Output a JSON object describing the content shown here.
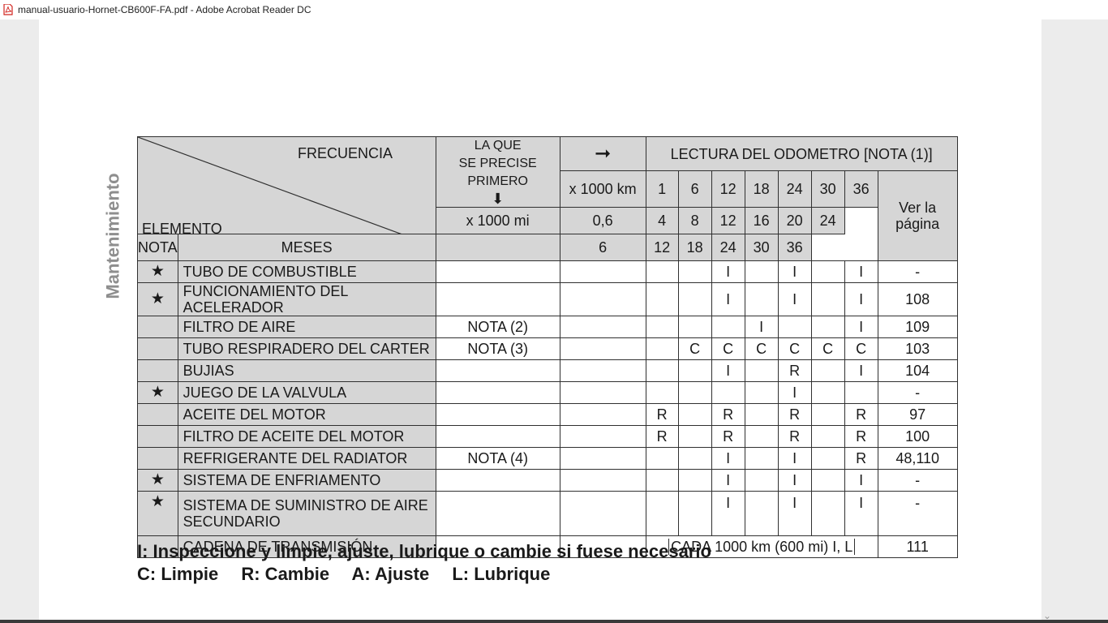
{
  "window": {
    "title": "manual-usuario-Hornet-CB600F-FA.pdf - Adobe Acrobat Reader DC"
  },
  "side_label": "Mantenimiento",
  "header": {
    "frecuencia": "FRECUENCIA",
    "elemento": "ELEMENTO",
    "la_que_lines": [
      "LA QUE",
      "SE PRECISE",
      "PRIMERO"
    ],
    "arrow_right": "➞",
    "arrow_down": "⬇",
    "lectura": "LECTURA DEL ODOMETRO [NOTA (1)]",
    "km_label": "x 1000 km",
    "mi_label": "x 1000 mi",
    "nota": "NOTA",
    "meses": "MESES",
    "ver_pagina": "Ver la página",
    "km_values": [
      "1",
      "6",
      "12",
      "18",
      "24",
      "30",
      "36"
    ],
    "mi_values": [
      "0,6",
      "4",
      "8",
      "12",
      "16",
      "20",
      "24"
    ],
    "month_values": [
      "",
      "6",
      "12",
      "18",
      "24",
      "30",
      "36"
    ]
  },
  "rows": [
    {
      "star": "★",
      "item": "TUBO DE COMBUSTIBLE",
      "nota": "",
      "c": [
        "",
        "",
        "I",
        "",
        "I",
        "",
        "I"
      ],
      "page": "-"
    },
    {
      "star": "★",
      "item": "FUNCIONAMIENTO DEL ACELERADOR",
      "nota": "",
      "c": [
        "",
        "",
        "I",
        "",
        "I",
        "",
        "I"
      ],
      "page": "108"
    },
    {
      "star": "",
      "item": "FILTRO DE AIRE",
      "nota": "NOTA (2)",
      "c": [
        "",
        "",
        "",
        "I",
        "",
        "",
        "I"
      ],
      "page": "109"
    },
    {
      "star": "",
      "item": "TUBO RESPIRADERO DEL CARTER",
      "nota": "NOTA (3)",
      "c": [
        "",
        "C",
        "C",
        "C",
        "C",
        "C",
        "C"
      ],
      "page": "103"
    },
    {
      "star": "",
      "item": "BUJIAS",
      "nota": "",
      "c": [
        "",
        "",
        "I",
        "",
        "R",
        "",
        "I"
      ],
      "page": "104"
    },
    {
      "star": "★",
      "item": "JUEGO DE LA VALVULA",
      "nota": "",
      "c": [
        "",
        "",
        "",
        "",
        "I",
        "",
        ""
      ],
      "page": "-"
    },
    {
      "star": "",
      "item": "ACEITE DEL MOTOR",
      "nota": "",
      "c": [
        "R",
        "",
        "R",
        "",
        "R",
        "",
        "R"
      ],
      "page": "97"
    },
    {
      "star": "",
      "item": "FILTRO DE ACEITE DEL MOTOR",
      "nota": "",
      "c": [
        "R",
        "",
        "R",
        "",
        "R",
        "",
        "R"
      ],
      "page": "100"
    },
    {
      "star": "",
      "item": "REFRIGERANTE DEL RADIATOR",
      "nota": "NOTA (4)",
      "c": [
        "",
        "",
        "I",
        "",
        "I",
        "",
        "R"
      ],
      "page": "48,110"
    },
    {
      "star": "★",
      "item": "SISTEMA DE ENFRIAMENTO",
      "nota": "",
      "c": [
        "",
        "",
        "I",
        "",
        "I",
        "",
        "I"
      ],
      "page": "-"
    }
  ],
  "tall_row": {
    "star": "★",
    "item_line1": "SISTEMA DE SUMINISTRO DE AIRE",
    "item_line2": "SECUNDARIO",
    "nota": "",
    "c": [
      "",
      "",
      "I",
      "",
      "I",
      "",
      "I"
    ],
    "page": "-"
  },
  "last_row": {
    "item": "CADENA DE TRANSMISIÓN",
    "span_text": "CADA 1000 km (600 mi)  I, L",
    "page": "111"
  },
  "legend": {
    "line1": "I: Inspeccione y limpie, ajuste, lubrique o cambie si fuese necesario",
    "line2": [
      "C: Limpie",
      "R: Cambie",
      "A: Ajuste",
      "L: Lubrique"
    ]
  }
}
